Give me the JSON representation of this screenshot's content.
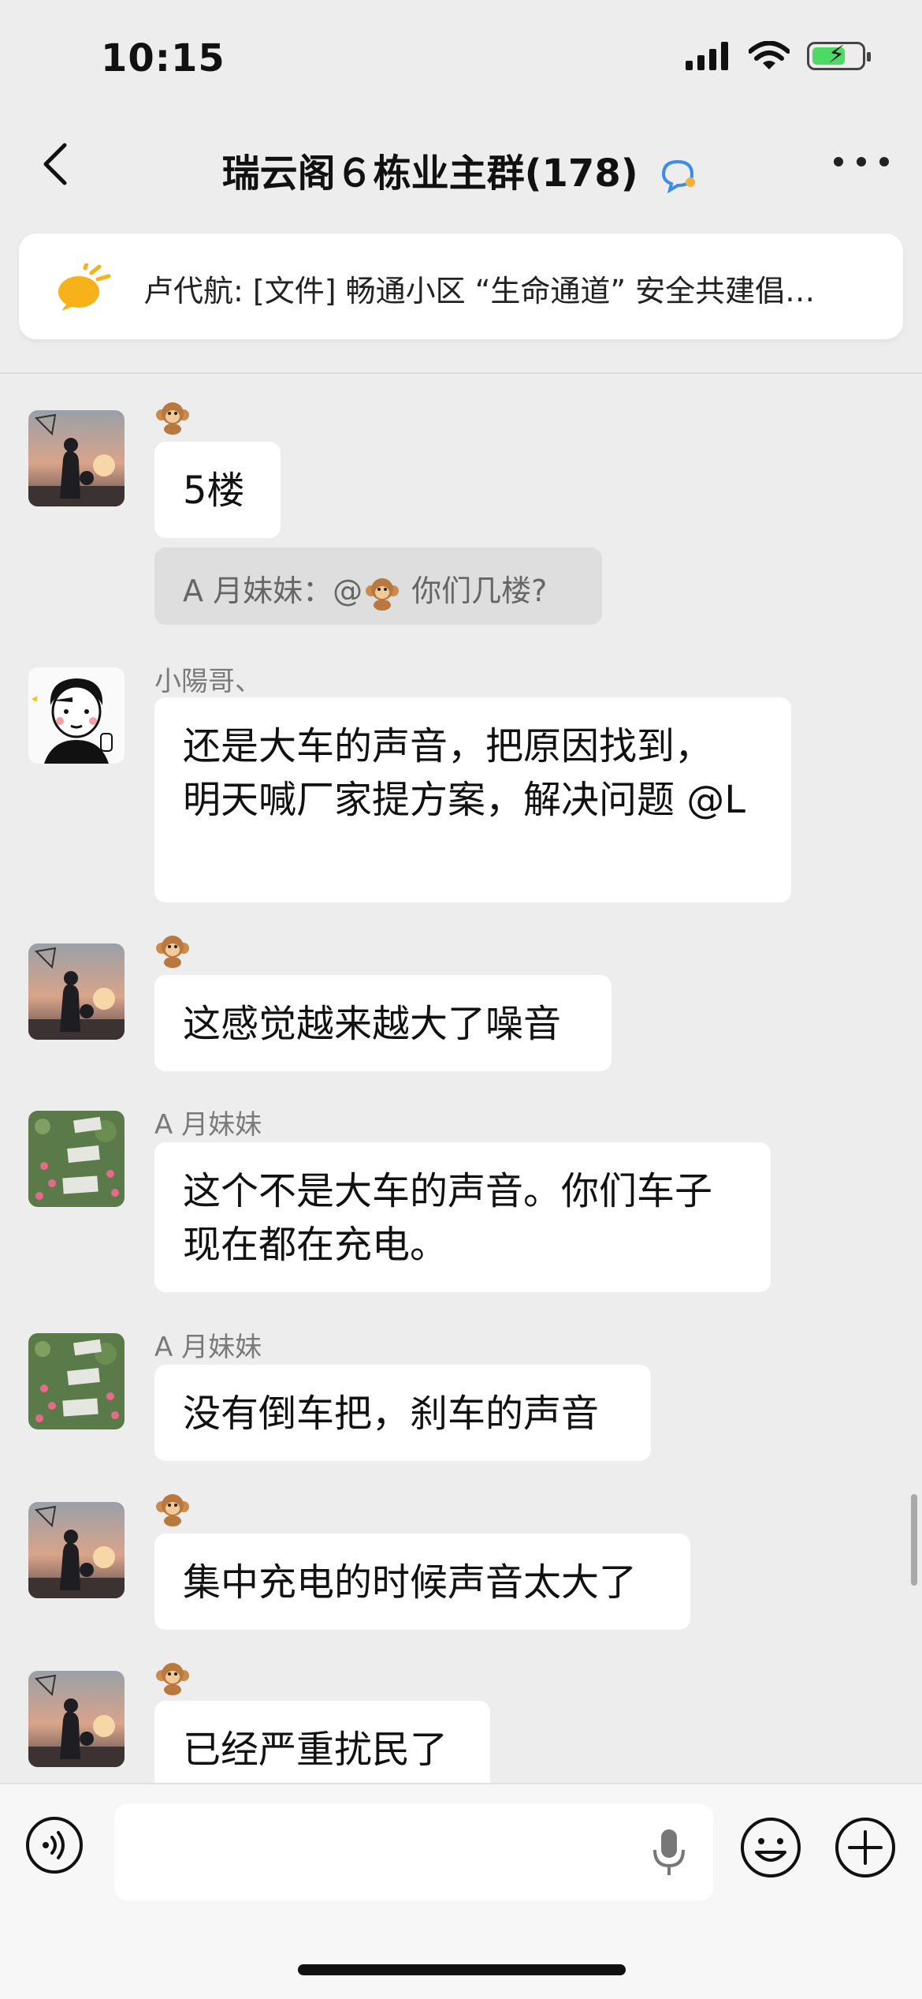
{
  "status": {
    "time": "10:15"
  },
  "nav": {
    "title": "瑞云阁６栋业主群(178)"
  },
  "pinned": {
    "text": "卢代航: [文件] 畅通小区 “生命通道” 安全共建倡…"
  },
  "messages": [
    {
      "sender": "",
      "text": "5楼"
    },
    {
      "quote_prefix": "A 月妹妹：@",
      "quote_suffix": " 你们几楼?"
    },
    {
      "sender": "小陽哥、",
      "line1": "还是大车的声音，把原因找到，",
      "line2": "明天喊厂家提方案，解决问题 @L"
    },
    {
      "sender": "",
      "text": "这感觉越来越大了噪音"
    },
    {
      "sender": "A 月妹妹",
      "line1": "这个不是大车的声音。你们车子",
      "line2": "现在都在充电。"
    },
    {
      "sender": "A 月妹妹",
      "text": "没有倒车把，刹车的声音"
    },
    {
      "sender": "",
      "text": "集中充电的时候声音太大了"
    },
    {
      "sender": "",
      "text": "已经严重扰民了"
    }
  ],
  "icons": {
    "back": "chevron-left-icon",
    "more": "more-dots-icon",
    "pinned": "announcement-icon",
    "voice": "voice-input-icon",
    "mic": "microphone-icon",
    "emoji": "emoji-icon",
    "plus": "plus-icon"
  },
  "colors": {
    "background": "#ededed",
    "bubble": "#ffffff",
    "quote": "#dedede",
    "battery": "#4cd964"
  }
}
